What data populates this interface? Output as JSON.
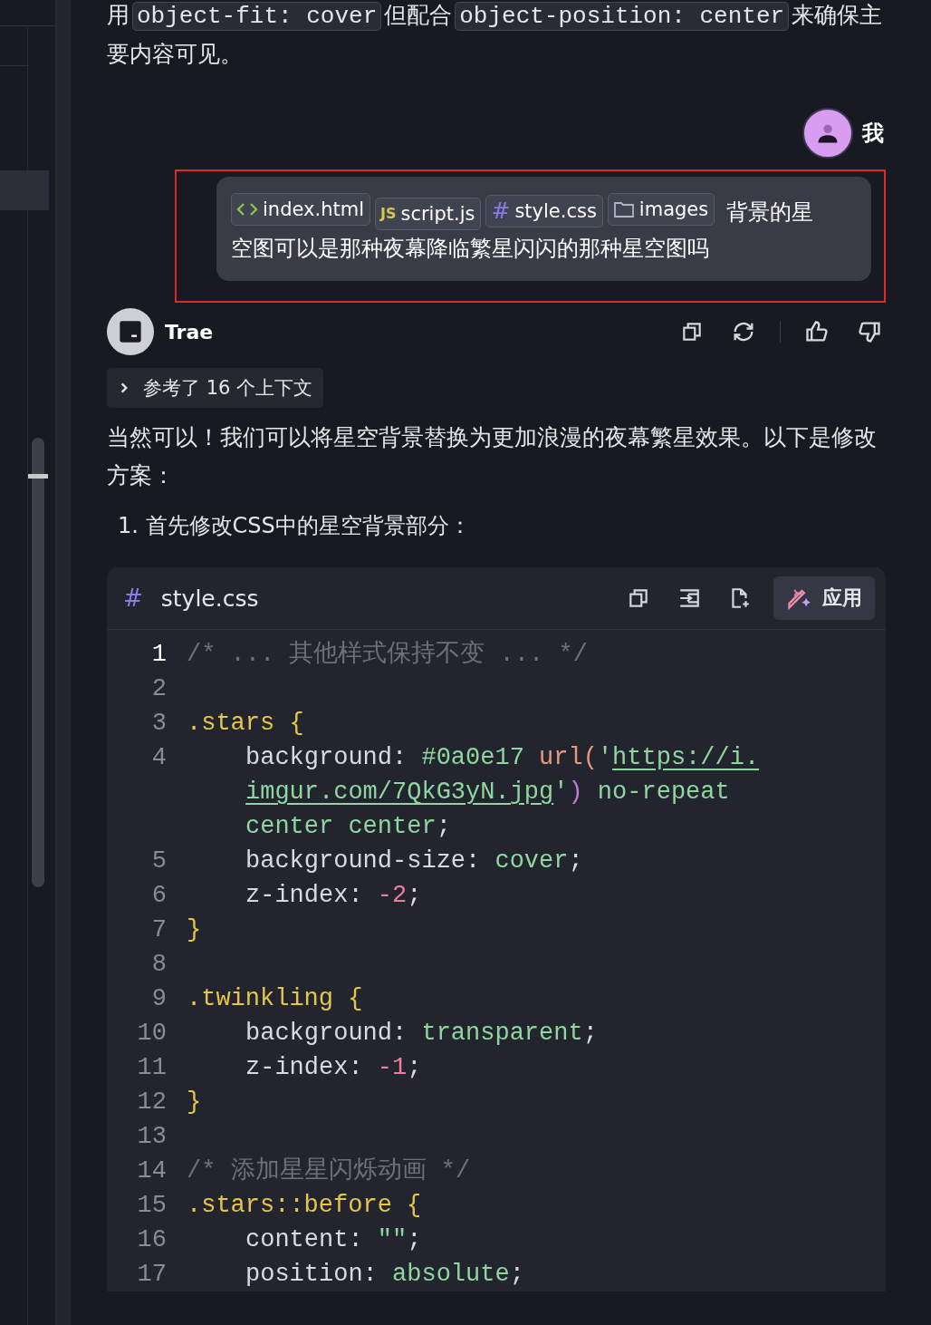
{
  "intro_paragraph": [
    {
      "kind": "text",
      "text": "用"
    },
    {
      "kind": "code",
      "text": "object-fit: cover"
    },
    {
      "kind": "text",
      "text": "但配合"
    },
    {
      "kind": "code",
      "text": "object-position: center"
    },
    {
      "kind": "text",
      "text": "来确保主要内容可见。"
    }
  ],
  "user_message": {
    "author": "我",
    "attachments": [
      {
        "kind": "html",
        "label": "index.html"
      },
      {
        "kind": "js",
        "icon_text": "JS",
        "label": "script.js"
      },
      {
        "kind": "css",
        "icon_text": "#",
        "label": "style.css"
      },
      {
        "kind": "folder",
        "label": "images"
      }
    ],
    "text_lines": [
      "背景的星",
      "空图可以是那种夜幕降临繁星闪闪的那种星空图吗"
    ],
    "highlighted": true
  },
  "assistant": {
    "name": "Trae",
    "context_toggle": {
      "label": "参考了 16 个上下文",
      "expanded": false
    },
    "paragraph": "当然可以！我们可以将星空背景替换为更加浪漫的夜幕繁星效果。以下是修改方案：",
    "list_item": "1. 首先修改CSS中的星空背景部分：",
    "code_block": {
      "icon_text": "#",
      "file_name": "style.css",
      "apply_label": "应用",
      "lines": [
        {
          "number": "1",
          "active": true,
          "indented": false,
          "segments": [
            {
              "kind": "comment",
              "text": "/* ... 其他样式保持不变 ... */"
            }
          ]
        },
        {
          "number": "2",
          "active": false
        },
        {
          "number": "3",
          "active": false,
          "indented": false,
          "segments": [
            {
              "kind": "selector",
              "text": ".stars {"
            }
          ]
        },
        {
          "number": "4",
          "active": false,
          "indented": true,
          "segments": [
            {
              "kind": "plain",
              "text": "background: "
            },
            {
              "kind": "value",
              "text": "#0a0e17"
            },
            {
              "kind": "func",
              "text": " url("
            },
            {
              "kind": "value",
              "text": "'"
            },
            {
              "kind": "url",
              "text": "https://i."
            }
          ]
        },
        {
          "indented": true,
          "segments": [
            {
              "kind": "url",
              "text": "imgur.com/7QkG3yN.jpg"
            },
            {
              "kind": "value",
              "text": "'"
            },
            {
              "kind": "paren",
              "text": ")"
            },
            {
              "kind": "value",
              "text": " no-repeat"
            }
          ]
        },
        {
          "indented": true,
          "segments": [
            {
              "kind": "value",
              "text": "center center"
            },
            {
              "kind": "plain",
              "text": ";"
            }
          ]
        },
        {
          "number": "5",
          "active": false,
          "indented": true,
          "segments": [
            {
              "kind": "plain",
              "text": "background-size: "
            },
            {
              "kind": "value",
              "text": "cover"
            },
            {
              "kind": "plain",
              "text": ";"
            }
          ]
        },
        {
          "number": "6",
          "active": false,
          "indented": true,
          "segments": [
            {
              "kind": "plain",
              "text": "z-index: "
            },
            {
              "kind": "number",
              "text": "-2"
            },
            {
              "kind": "plain",
              "text": ";"
            }
          ]
        },
        {
          "number": "7",
          "active": false,
          "indented": false,
          "segments": [
            {
              "kind": "selector",
              "text": "}"
            }
          ]
        },
        {
          "number": "8",
          "active": false
        },
        {
          "number": "9",
          "active": false,
          "indented": false,
          "segments": [
            {
              "kind": "selector",
              "text": ".twinkling {"
            }
          ]
        },
        {
          "number": "10",
          "active": false,
          "indented": true,
          "segments": [
            {
              "kind": "plain",
              "text": "background: "
            },
            {
              "kind": "value",
              "text": "transparent"
            },
            {
              "kind": "plain",
              "text": ";"
            }
          ]
        },
        {
          "number": "11",
          "active": false,
          "indented": true,
          "segments": [
            {
              "kind": "plain",
              "text": "z-index: "
            },
            {
              "kind": "number",
              "text": "-1"
            },
            {
              "kind": "plain",
              "text": ";"
            }
          ]
        },
        {
          "number": "12",
          "active": false,
          "indented": false,
          "segments": [
            {
              "kind": "selector",
              "text": "}"
            }
          ]
        },
        {
          "number": "13",
          "active": false
        },
        {
          "number": "14",
          "active": false,
          "indented": false,
          "segments": [
            {
              "kind": "comment",
              "text": "/* 添加星星闪烁动画 */"
            }
          ]
        },
        {
          "number": "15",
          "active": false,
          "indented": false,
          "segments": [
            {
              "kind": "selector",
              "text": ".stars::before {"
            }
          ]
        },
        {
          "number": "16",
          "active": false,
          "indented": true,
          "segments": [
            {
              "kind": "plain",
              "text": "content: "
            },
            {
              "kind": "value",
              "text": "\"\""
            },
            {
              "kind": "plain",
              "text": ";"
            }
          ]
        },
        {
          "number": "17",
          "active": false,
          "indented": true,
          "segments": [
            {
              "kind": "plain",
              "text": "position: "
            },
            {
              "kind": "value",
              "text": "absolute"
            },
            {
              "kind": "plain",
              "text": ";"
            }
          ]
        }
      ]
    }
  }
}
